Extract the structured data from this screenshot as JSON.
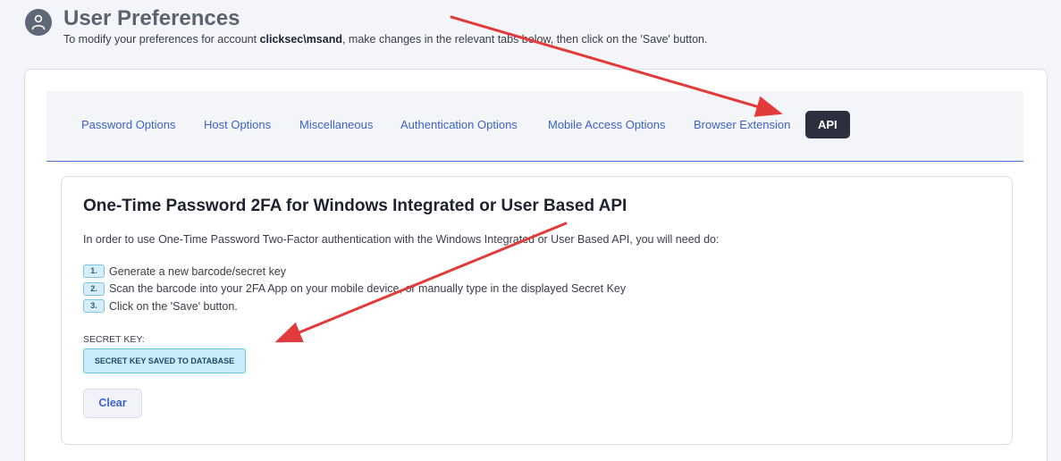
{
  "header": {
    "title": "User Preferences",
    "subtitle_prefix": "To modify your preferences for account ",
    "account": "clicksec\\msand",
    "subtitle_suffix": ", make changes in the relevant tabs below, then click on the 'Save' button.",
    "avatar_icon": "user-icon"
  },
  "tabs": [
    {
      "label": "Password Options",
      "active": false
    },
    {
      "label": "Host Options",
      "active": false
    },
    {
      "label": "Miscellaneous",
      "active": false
    },
    {
      "label": "Authentication Options",
      "active": false
    },
    {
      "label": "Mobile Access Options",
      "active": false
    },
    {
      "label": "Browser Extension",
      "active": false
    },
    {
      "label": "API",
      "active": true
    }
  ],
  "panel": {
    "title": "One-Time Password 2FA for Windows Integrated or User Based API",
    "intro": "In order to use One-Time Password Two-Factor authentication with the Windows Integrated or User Based API, you will need do:",
    "steps": [
      {
        "num": "1.",
        "text": "Generate a new barcode/secret key"
      },
      {
        "num": "2.",
        "text": "Scan the barcode into your 2FA App on your mobile device, or manually type in the displayed Secret Key"
      },
      {
        "num": "3.",
        "text": "Click on the 'Save' button."
      }
    ],
    "secret_label": "SECRET KEY:",
    "secret_status": "SECRET KEY SAVED TO DATABASE",
    "clear_label": "Clear"
  },
  "colors": {
    "accent": "#3b63c9",
    "active_tab_bg": "#2b2f3f",
    "annotation_arrow": "#e23b3b",
    "badge_bg": "#c9ecfb"
  }
}
